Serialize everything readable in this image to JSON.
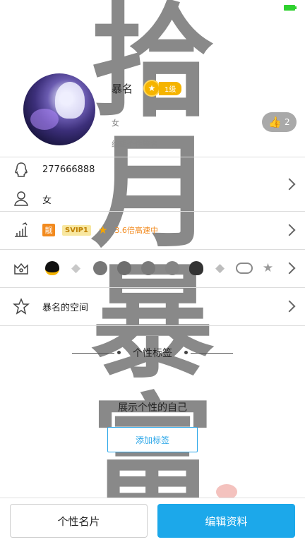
{
  "profile": {
    "nickname": "暴名",
    "level_label": "1级",
    "gender_line": "女",
    "signature": "编辑个性签名",
    "like_count": "2"
  },
  "info_rows": {
    "qq_number": "277666888",
    "gender": "女"
  },
  "vip_row": {
    "liang_badge": "靓",
    "svip_badge": "SVIP1",
    "vip_info": "3.6倍高速中"
  },
  "medals": [
    "penguin-medal-icon",
    "diamond-medal-icon",
    "penguin-gray-medal-icon",
    "penguin-gray-medal-icon",
    "penguin-gray-medal-icon",
    "penguin-gray-medal-icon",
    "penguin-black-medal-icon",
    "diamond-gray-medal-icon",
    "vip-cloud-medal-icon",
    "star-gray-medal-icon"
  ],
  "space_row": {
    "label": "暴名的空间"
  },
  "tags": {
    "title": "个性标签",
    "empty_text": "展示个性的自己",
    "add_button": "添加标签"
  },
  "bottom_bar": {
    "card_button": "个性名片",
    "edit_button": "编辑资料"
  },
  "watermark": {
    "chars": [
      "拾",
      "月",
      "暴",
      "富"
    ]
  },
  "colors": {
    "accent": "#1ca8ea",
    "vip_orange": "#f28a1e",
    "level_gold": "#f5b400",
    "battery_green": "#2fd12f"
  }
}
